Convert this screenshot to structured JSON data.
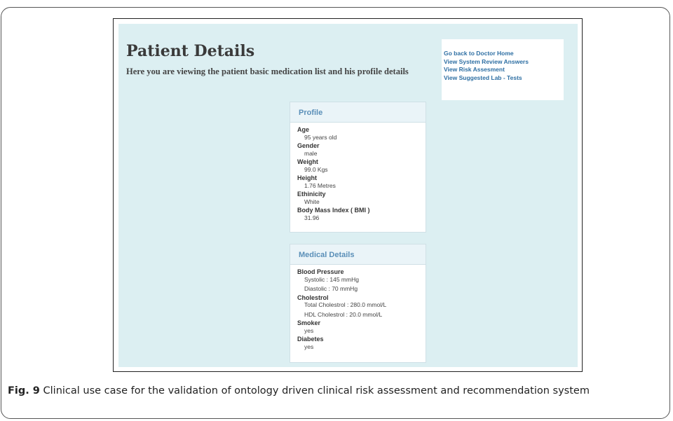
{
  "page": {
    "title": "Patient Details",
    "subtitle": "Here you are viewing the patient basic medication list and his profile details"
  },
  "nav_links": [
    "Go back to Doctor Home",
    "View System Review Answers",
    "View Risk Assesment",
    "View Suggested Lab - Tests"
  ],
  "profile": {
    "header": "Profile",
    "fields": [
      {
        "label": "Age",
        "value": "95 years old"
      },
      {
        "label": "Gender",
        "value": "male"
      },
      {
        "label": "Weight",
        "value": "99.0 Kgs"
      },
      {
        "label": "Height",
        "value": "1.76 Metres"
      },
      {
        "label": "Ethinicity",
        "value": "White"
      },
      {
        "label": "Body Mass Index ( BMI )",
        "value": "31.96"
      }
    ]
  },
  "medical": {
    "header": "Medical Details",
    "blood_pressure": {
      "label": "Blood Pressure",
      "systolic": "Systolic : 145 mmHg",
      "diastolic": "Diastolic : 70 mmHg"
    },
    "cholestrol": {
      "label": "Cholestrol",
      "total": "Total Cholestrol : 280.0 mmol/L",
      "hdl": "HDL Cholestrol : 20.0 mmol/L"
    },
    "smoker": {
      "label": "Smoker",
      "value": "yes"
    },
    "diabetes": {
      "label": "Diabetes",
      "value": "yes"
    }
  },
  "caption": {
    "label": "Fig. 9",
    "text": "Clinical use case for the validation of ontology driven clinical risk assessment and recommendation system"
  }
}
